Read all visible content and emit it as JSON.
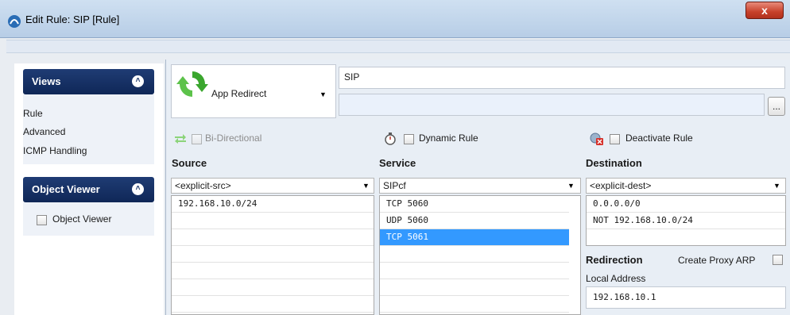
{
  "window": {
    "title": "Edit Rule: SIP [Rule]",
    "close_glyph": "x"
  },
  "views_panel": {
    "title": "Views",
    "items": [
      "Rule",
      "Advanced",
      "ICMP Handling"
    ]
  },
  "object_viewer_panel": {
    "title": "Object Viewer",
    "checkbox_label": "Object Viewer"
  },
  "rule": {
    "action_label": "App Redirect",
    "name": "SIP",
    "comment": "",
    "ellipsis": "...",
    "bidirectional_label": "Bi-Directional",
    "dynamic_label": "Dynamic Rule",
    "deactivate_label": "Deactivate Rule"
  },
  "source": {
    "header": "Source",
    "selected": "<explicit-src>",
    "entries": [
      "192.168.10.0/24"
    ]
  },
  "service": {
    "header": "Service",
    "selected": "SIPcf",
    "entries": [
      "TCP  5060",
      "UDP  5060",
      "TCP  5061"
    ],
    "selected_index": 2
  },
  "destination": {
    "header": "Destination",
    "selected": "<explicit-dest>",
    "entries": [
      "0.0.0.0/0",
      "NOT 192.168.10.0/24"
    ]
  },
  "redirection": {
    "header": "Redirection",
    "proxy_arp_label": "Create Proxy ARP",
    "local_address_label": "Local Address",
    "local_address": "192.168.10.1"
  },
  "colors": {
    "accent": "#1f3c74",
    "selection": "#3399ff"
  }
}
